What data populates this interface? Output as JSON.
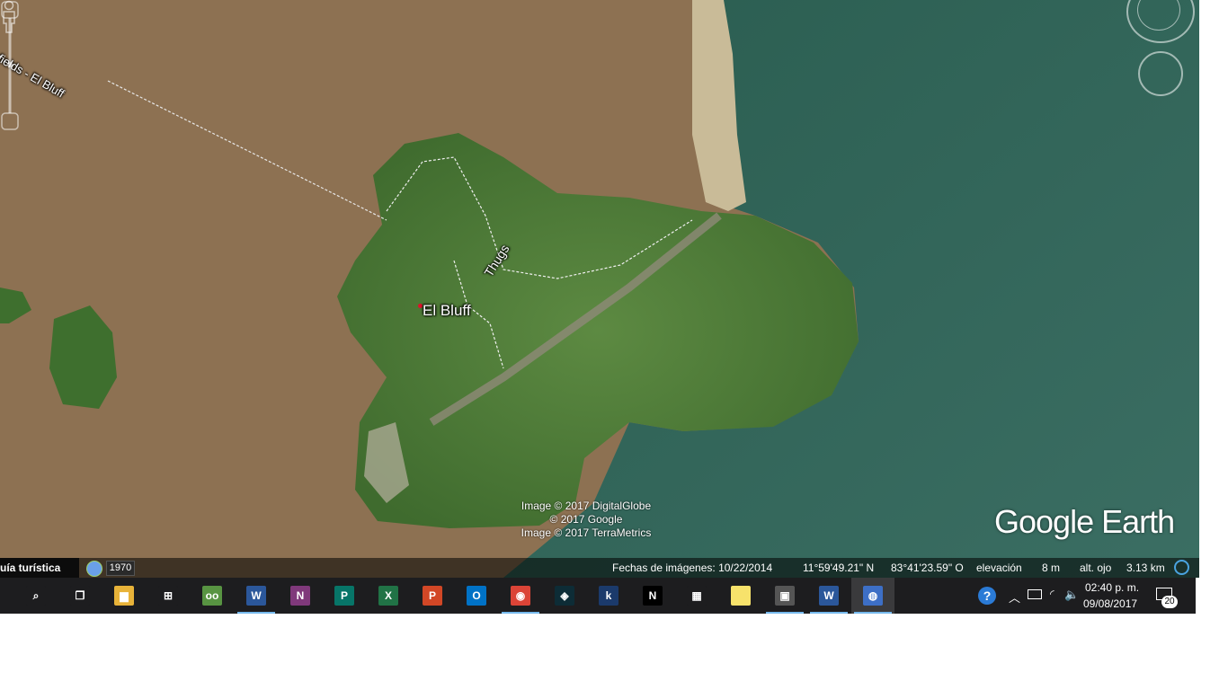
{
  "map": {
    "road_label_bluefields": "uefields - El Bluff",
    "road_label_thugs": "Thugs",
    "place_label": "El Bluff",
    "credits": [
      "Image © 2017 DigitalGlobe",
      "© 2017 Google",
      "Image © 2017 TerraMetrics"
    ],
    "logo_google": "Google",
    "logo_earth": "Earth"
  },
  "status_bar": {
    "sidebar_tab": "uía turística",
    "historical_year": "1970",
    "imagery_date": "Fechas de imágenes: 10/22/2014",
    "latitude": "11°59'49.21\" N",
    "longitude": "83°41'23.59\" O",
    "elevation_label": "elevación",
    "elevation_value": "8 m",
    "eye_alt_label": "alt. ojo",
    "eye_alt_value": "3.13 km"
  },
  "taskbar": {
    "apps": [
      {
        "name": "search-icon",
        "glyph": "⌕",
        "color": "#1d1d1f"
      },
      {
        "name": "task-view-icon",
        "glyph": "❐",
        "color": "#1d1d1f"
      },
      {
        "name": "file-explorer-icon",
        "glyph": "▆",
        "color": "#e8b339"
      },
      {
        "name": "store-icon",
        "glyph": "⊞",
        "color": "#1d1d1f"
      },
      {
        "name": "tripadvisor-icon",
        "glyph": "oo",
        "color": "#589442"
      },
      {
        "name": "word-icon",
        "glyph": "W",
        "color": "#2b579a"
      },
      {
        "name": "onenote-icon",
        "glyph": "N",
        "color": "#80397b"
      },
      {
        "name": "publisher-icon",
        "glyph": "P",
        "color": "#077568"
      },
      {
        "name": "excel-icon",
        "glyph": "X",
        "color": "#217346"
      },
      {
        "name": "powerpoint-icon",
        "glyph": "P",
        "color": "#d24726"
      },
      {
        "name": "outlook-icon",
        "glyph": "O",
        "color": "#0072c6"
      },
      {
        "name": "chrome-icon",
        "glyph": "◉",
        "color": "#db4437"
      },
      {
        "name": "kindle-app-icon",
        "glyph": "◈",
        "color": "#0d2c36"
      },
      {
        "name": "kindle-icon",
        "glyph": "k",
        "color": "#1b3a6b"
      },
      {
        "name": "netflix-icon",
        "glyph": "N",
        "color": "#000000"
      },
      {
        "name": "calculator-icon",
        "glyph": "▦",
        "color": "#1d1d1f"
      },
      {
        "name": "sticky-notes-icon",
        "glyph": "",
        "color": "#f7e26b"
      },
      {
        "name": "photo-app-icon",
        "glyph": "▣",
        "color": "#555555"
      },
      {
        "name": "word-doc-icon",
        "glyph": "W",
        "color": "#2b579a"
      },
      {
        "name": "google-earth-icon",
        "glyph": "◍",
        "color": "#3d6fc6"
      }
    ],
    "clock_time": "02:40 p. m.",
    "clock_date": "09/08/2017",
    "notification_count": "20"
  }
}
